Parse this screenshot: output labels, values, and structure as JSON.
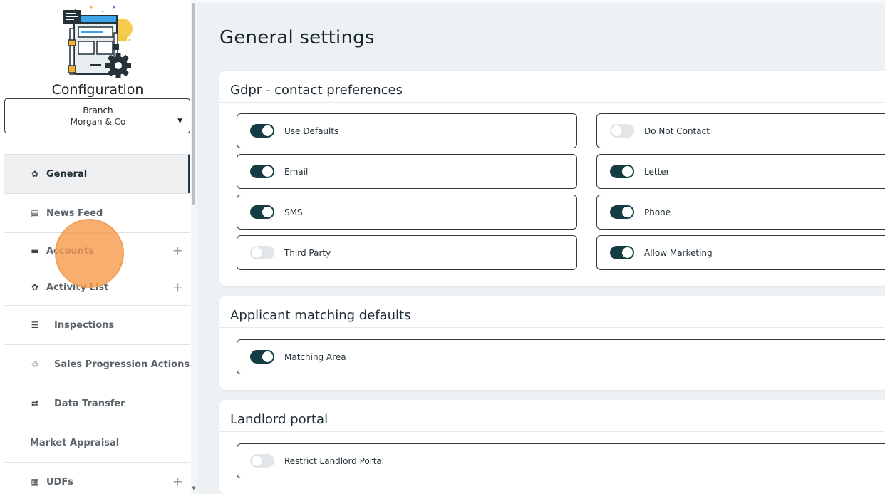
{
  "sidebar": {
    "title": "Configuration",
    "branch": {
      "label": "Branch",
      "value": "Morgan & Co"
    },
    "items": [
      {
        "label": "General",
        "icon": "gear-icon",
        "active": true,
        "expandable": false
      },
      {
        "label": "News Feed",
        "icon": "newspaper-icon",
        "active": false,
        "expandable": false
      },
      {
        "label": "Accounts",
        "icon": "credit-card-icon",
        "active": false,
        "expandable": true
      },
      {
        "label": "Activity List",
        "icon": "gear-icon",
        "active": false,
        "expandable": true
      },
      {
        "label": "Inspections",
        "icon": "checklist-icon",
        "active": false,
        "expandable": false
      },
      {
        "label": "Sales Progression Actions",
        "icon": "webhook-icon",
        "active": false,
        "expandable": false
      },
      {
        "label": "Data Transfer",
        "icon": "transfer-arrows-icon",
        "active": false,
        "expandable": false
      },
      {
        "label": "Market Appraisal",
        "icon": "",
        "active": false,
        "expandable": false
      },
      {
        "label": "UDFs",
        "icon": "table-icon",
        "active": false,
        "expandable": true
      }
    ],
    "plus_symbol": "+"
  },
  "main": {
    "title": "General settings",
    "sections": [
      {
        "title": "Gdpr - contact preferences",
        "toggles": [
          {
            "label": "Use Defaults",
            "on": true
          },
          {
            "label": "Do Not Contact",
            "on": false
          },
          {
            "label": "Email",
            "on": true
          },
          {
            "label": "Letter",
            "on": true
          },
          {
            "label": "SMS",
            "on": true
          },
          {
            "label": "Phone",
            "on": true
          },
          {
            "label": "Third Party",
            "on": false
          },
          {
            "label": "Allow Marketing",
            "on": true
          }
        ]
      },
      {
        "title": "Applicant matching defaults",
        "toggles": [
          {
            "label": "Matching Area",
            "on": true
          }
        ]
      },
      {
        "title": "Landlord portal",
        "toggles": [
          {
            "label": "Restrict Landlord Portal",
            "on": false
          }
        ]
      }
    ]
  },
  "colors": {
    "toggle_on": "#153b44",
    "toggle_off": "#e3e6e9",
    "click_indicator": "#f59746",
    "active_nav_bg": "#eef0f2"
  }
}
